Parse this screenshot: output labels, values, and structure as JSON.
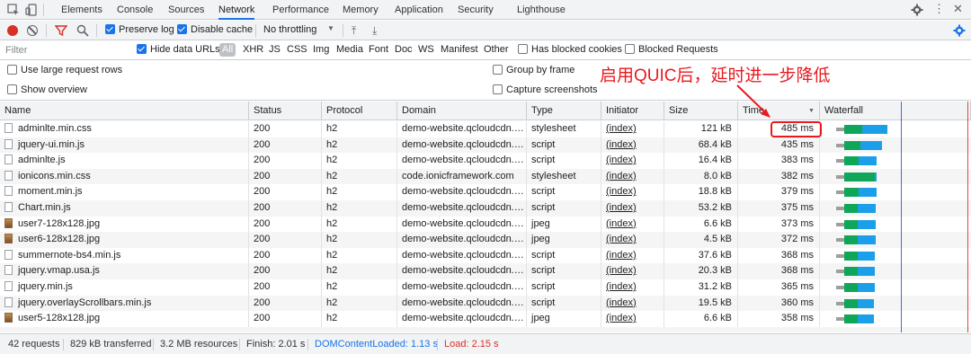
{
  "tabbar": {
    "tabs": [
      "Elements",
      "Console",
      "Sources",
      "Network",
      "Performance",
      "Memory",
      "Application",
      "Security",
      "Lighthouse"
    ],
    "active": "Network",
    "icons": [
      "inspect-icon",
      "device-toolbar-icon",
      "gear-icon",
      "kebab-menu-icon",
      "close-icon"
    ]
  },
  "toolbar": {
    "preserve_log": "Preserve log",
    "disable_cache": "Disable cache",
    "throttling": "No throttling",
    "icons": [
      "record-icon",
      "clear-icon",
      "filter-icon",
      "search-icon",
      "upload-icon",
      "download-icon",
      "gear-icon"
    ]
  },
  "filterbar": {
    "placeholder": "Filter",
    "hide_data_urls": "Hide data URLs",
    "types": [
      "All",
      "XHR",
      "JS",
      "CSS",
      "Img",
      "Media",
      "Font",
      "Doc",
      "WS",
      "Manifest",
      "Other"
    ],
    "has_blocked_cookies": "Has blocked cookies",
    "blocked_requests": "Blocked Requests"
  },
  "options": {
    "large_rows": "Use large request rows",
    "show_overview": "Show overview",
    "group_by_frame": "Group by frame",
    "capture_screenshots": "Capture screenshots"
  },
  "annotation": {
    "text": "启用QUIC后，延时进一步降低",
    "color": "#e8191f"
  },
  "table": {
    "columns": [
      "Name",
      "Status",
      "Protocol",
      "Domain",
      "Type",
      "Initiator",
      "Size",
      "Time",
      "Waterfall"
    ],
    "rows": [
      {
        "name": "adminlte.min.css",
        "icon": "file-icon",
        "status": "200",
        "protocol": "h2",
        "domain": "demo-website.qcloudcdn.c...",
        "type": "stylesheet",
        "initiator": "(index)",
        "size": "121 kB",
        "time": "485 ms"
      },
      {
        "name": "jquery-ui.min.js",
        "icon": "file-icon",
        "status": "200",
        "protocol": "h2",
        "domain": "demo-website.qcloudcdn.c...",
        "type": "script",
        "initiator": "(index)",
        "size": "68.4 kB",
        "time": "435 ms"
      },
      {
        "name": "adminlte.js",
        "icon": "file-icon",
        "status": "200",
        "protocol": "h2",
        "domain": "demo-website.qcloudcdn.c...",
        "type": "script",
        "initiator": "(index)",
        "size": "16.4 kB",
        "time": "383 ms"
      },
      {
        "name": "ionicons.min.css",
        "icon": "file-icon",
        "status": "200",
        "protocol": "h2",
        "domain": "code.ionicframework.com",
        "type": "stylesheet",
        "initiator": "(index)",
        "size": "8.0 kB",
        "time": "382 ms"
      },
      {
        "name": "moment.min.js",
        "icon": "file-icon",
        "status": "200",
        "protocol": "h2",
        "domain": "demo-website.qcloudcdn.c...",
        "type": "script",
        "initiator": "(index)",
        "size": "18.8 kB",
        "time": "379 ms"
      },
      {
        "name": "Chart.min.js",
        "icon": "file-icon",
        "status": "200",
        "protocol": "h2",
        "domain": "demo-website.qcloudcdn.c...",
        "type": "script",
        "initiator": "(index)",
        "size": "53.2 kB",
        "time": "375 ms"
      },
      {
        "name": "user7-128x128.jpg",
        "icon": "image-icon",
        "status": "200",
        "protocol": "h2",
        "domain": "demo-website.qcloudcdn.c...",
        "type": "jpeg",
        "initiator": "(index)",
        "size": "6.6 kB",
        "time": "373 ms"
      },
      {
        "name": "user6-128x128.jpg",
        "icon": "image-icon",
        "status": "200",
        "protocol": "h2",
        "domain": "demo-website.qcloudcdn.c...",
        "type": "jpeg",
        "initiator": "(index)",
        "size": "4.5 kB",
        "time": "372 ms"
      },
      {
        "name": "summernote-bs4.min.js",
        "icon": "file-icon",
        "status": "200",
        "protocol": "h2",
        "domain": "demo-website.qcloudcdn.c...",
        "type": "script",
        "initiator": "(index)",
        "size": "37.6 kB",
        "time": "368 ms"
      },
      {
        "name": "jquery.vmap.usa.js",
        "icon": "file-icon",
        "status": "200",
        "protocol": "h2",
        "domain": "demo-website.qcloudcdn.c...",
        "type": "script",
        "initiator": "(index)",
        "size": "20.3 kB",
        "time": "368 ms"
      },
      {
        "name": "jquery.min.js",
        "icon": "file-icon",
        "status": "200",
        "protocol": "h2",
        "domain": "demo-website.qcloudcdn.c...",
        "type": "script",
        "initiator": "(index)",
        "size": "31.2 kB",
        "time": "365 ms"
      },
      {
        "name": "jquery.overlayScrollbars.min.js",
        "icon": "file-icon",
        "status": "200",
        "protocol": "h2",
        "domain": "demo-website.qcloudcdn.c...",
        "type": "script",
        "initiator": "(index)",
        "size": "19.5 kB",
        "time": "360 ms"
      },
      {
        "name": "user5-128x128.jpg",
        "icon": "image-icon",
        "status": "200",
        "protocol": "h2",
        "domain": "demo-website.qcloudcdn.c...",
        "type": "jpeg",
        "initiator": "(index)",
        "size": "6.6 kB",
        "time": "358 ms"
      }
    ]
  },
  "statusbar": {
    "requests": "42 requests",
    "transferred": "829 kB transferred",
    "resources": "3.2 MB resources",
    "finish": "Finish: 2.01 s",
    "dom_content_loaded": "DOMContentLoaded: 1.13 s",
    "load": "Load: 2.15 s"
  },
  "colors": {
    "accent": "#1a73e8",
    "record": "#d93025",
    "waterfall_waiting": "#0fa65a",
    "waterfall_download": "#1a9fe8",
    "dom_line": "#3a6fd8",
    "load_line": "#e04b3a"
  }
}
